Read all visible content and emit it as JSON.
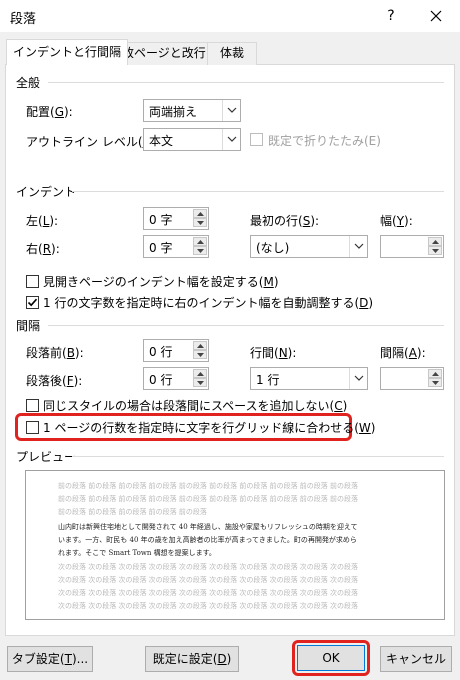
{
  "window": {
    "title": "段落",
    "help": "?"
  },
  "tabs": [
    {
      "label": "インデントと行間隔"
    },
    {
      "label": "改ページと改行"
    },
    {
      "label": "体裁"
    }
  ],
  "general": {
    "section": "全般",
    "alignment": {
      "label": "配置(",
      "key": "G",
      "end": "):",
      "value": "両端揃え"
    },
    "outline": {
      "label": "アウトライン レベル(",
      "key": "O",
      "end": "):",
      "value": "本文"
    },
    "collapsed": {
      "label": "既定で折りたたみ(E)",
      "checked": false,
      "disabled": true
    }
  },
  "indent": {
    "section": "インデント",
    "left": {
      "label": "左(",
      "key": "L",
      "end": "):",
      "value": "0 字"
    },
    "right": {
      "label": "右(",
      "key": "R",
      "end": "):",
      "value": "0 字"
    },
    "first_line": {
      "label": "最初の行(",
      "key": "S",
      "end": "):",
      "value": "(なし)"
    },
    "width": {
      "label": "幅(",
      "key": "Y",
      "end": "):",
      "value": ""
    },
    "mirror": {
      "label": "見開きページのインデント幅を設定する(",
      "key": "M",
      "end": ")",
      "checked": false
    },
    "auto_adjust": {
      "label": "1 行の文字数を指定時に右のインデント幅を自動調整する(",
      "key": "D",
      "end": ")",
      "checked": true
    }
  },
  "spacing": {
    "section": "間隔",
    "before": {
      "label": "段落前(",
      "key": "B",
      "end": "):",
      "value": "0 行"
    },
    "after": {
      "label": "段落後(",
      "key": "F",
      "end": "):",
      "value": "0 行"
    },
    "line_spacing": {
      "label": "行間(",
      "key": "N",
      "end": "):",
      "value": "1 行"
    },
    "at": {
      "label": "間隔(",
      "key": "A",
      "end": "):",
      "value": ""
    },
    "no_space_same_style": {
      "label": "同じスタイルの場合は段落間にスペースを追加しない(",
      "key": "C",
      "end": ")",
      "checked": false
    },
    "snap_to_grid": {
      "label": "1 ページの行数を指定時に文字を行グリッド線に合わせる(",
      "key": "W",
      "end": ")",
      "checked": false
    }
  },
  "preview": {
    "section": "プレビュー",
    "prev_lines": [
      "前の段落 前の段落 前の段落 前の段落 前の段落 前の段落 前の段落 前の段落 前の段落 前の段落",
      "前の段落 前の段落 前の段落 前の段落 前の段落 前の段落 前の段落 前の段落 前の段落 前の段落",
      "前の段落 前の段落 前の段落 前の段落 前の段落"
    ],
    "sample_lines": [
      "山内町は新興住宅地として開発されて 40 年経過し、施設や家屋もリフレッシュの時期を迎えて",
      "います。一方、町民も 40 年の歳を加え高齢者の比率が高まってきました。町の再開発が求めら",
      "れます。そこで Smart Town 構想を提案します。"
    ],
    "next_lines": [
      "次の段落 次の段落 次の段落 次の段落 次の段落 次の段落 次の段落 次の段落 次の段落 次の段落",
      "次の段落 次の段落 次の段落 次の段落 次の段落 次の段落 次の段落 次の段落 次の段落 次の段落",
      "次の段落 次の段落 次の段落 次の段落 次の段落 次の段落 次の段落 次の段落 次の段落 次の段落",
      "次の段落 次の段落 次の段落 次の段落 次の段落 次の段落 次の段落 次の段落 次の段落 次の段落",
      "次の段落 次の段落 次の段落 次の段落 次の段落"
    ]
  },
  "buttons": {
    "tabs": {
      "label": "タブ設定(",
      "key": "T",
      "end": ")..."
    },
    "set_default": {
      "label": "既定に設定(",
      "key": "D",
      "end": ")"
    },
    "ok": "OK",
    "cancel": "キャンセル"
  },
  "colors": {
    "highlight": "#e0231f",
    "disabled": "#a0a0a0"
  }
}
